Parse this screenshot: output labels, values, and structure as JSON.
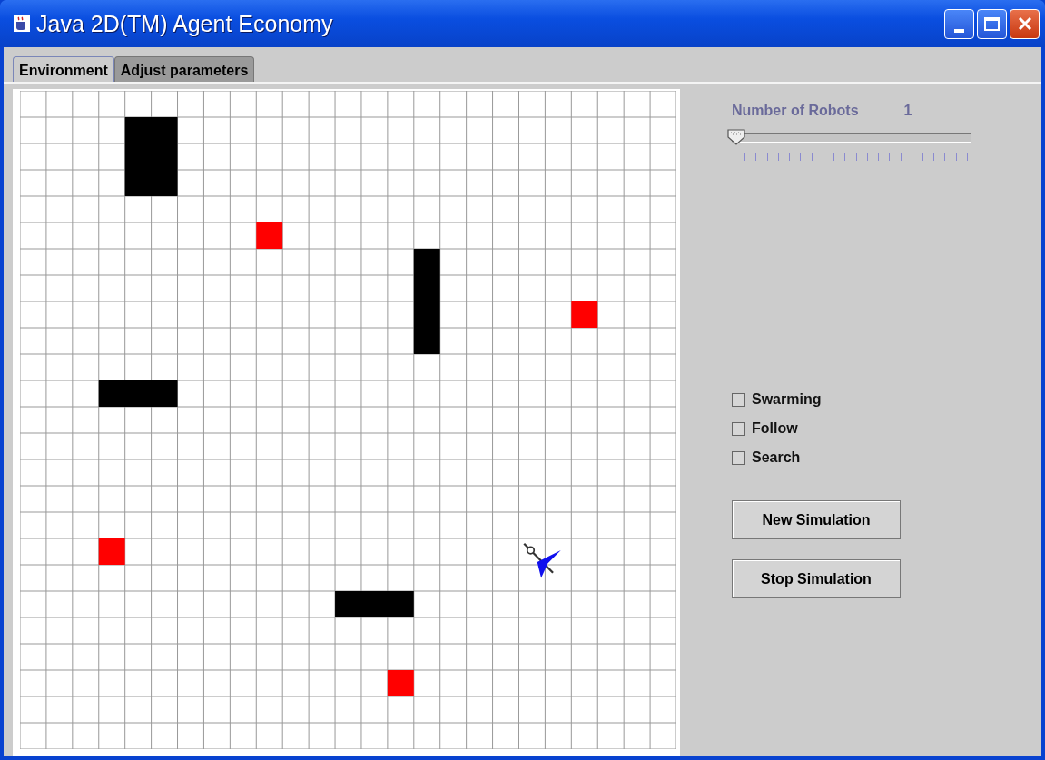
{
  "window": {
    "title": "Java 2D(TM) Agent Economy"
  },
  "tabs": [
    {
      "label": "Environment",
      "selected": true
    },
    {
      "label": "Adjust parameters",
      "selected": false
    }
  ],
  "robots": {
    "label": "Number of Robots",
    "value": "1",
    "level": 0
  },
  "options": [
    {
      "label": "Swarming",
      "checked": false
    },
    {
      "label": "Follow",
      "checked": false
    },
    {
      "label": "Search",
      "checked": false
    }
  ],
  "buttons": [
    "New Simulation",
    "Stop Simulation"
  ]
}
